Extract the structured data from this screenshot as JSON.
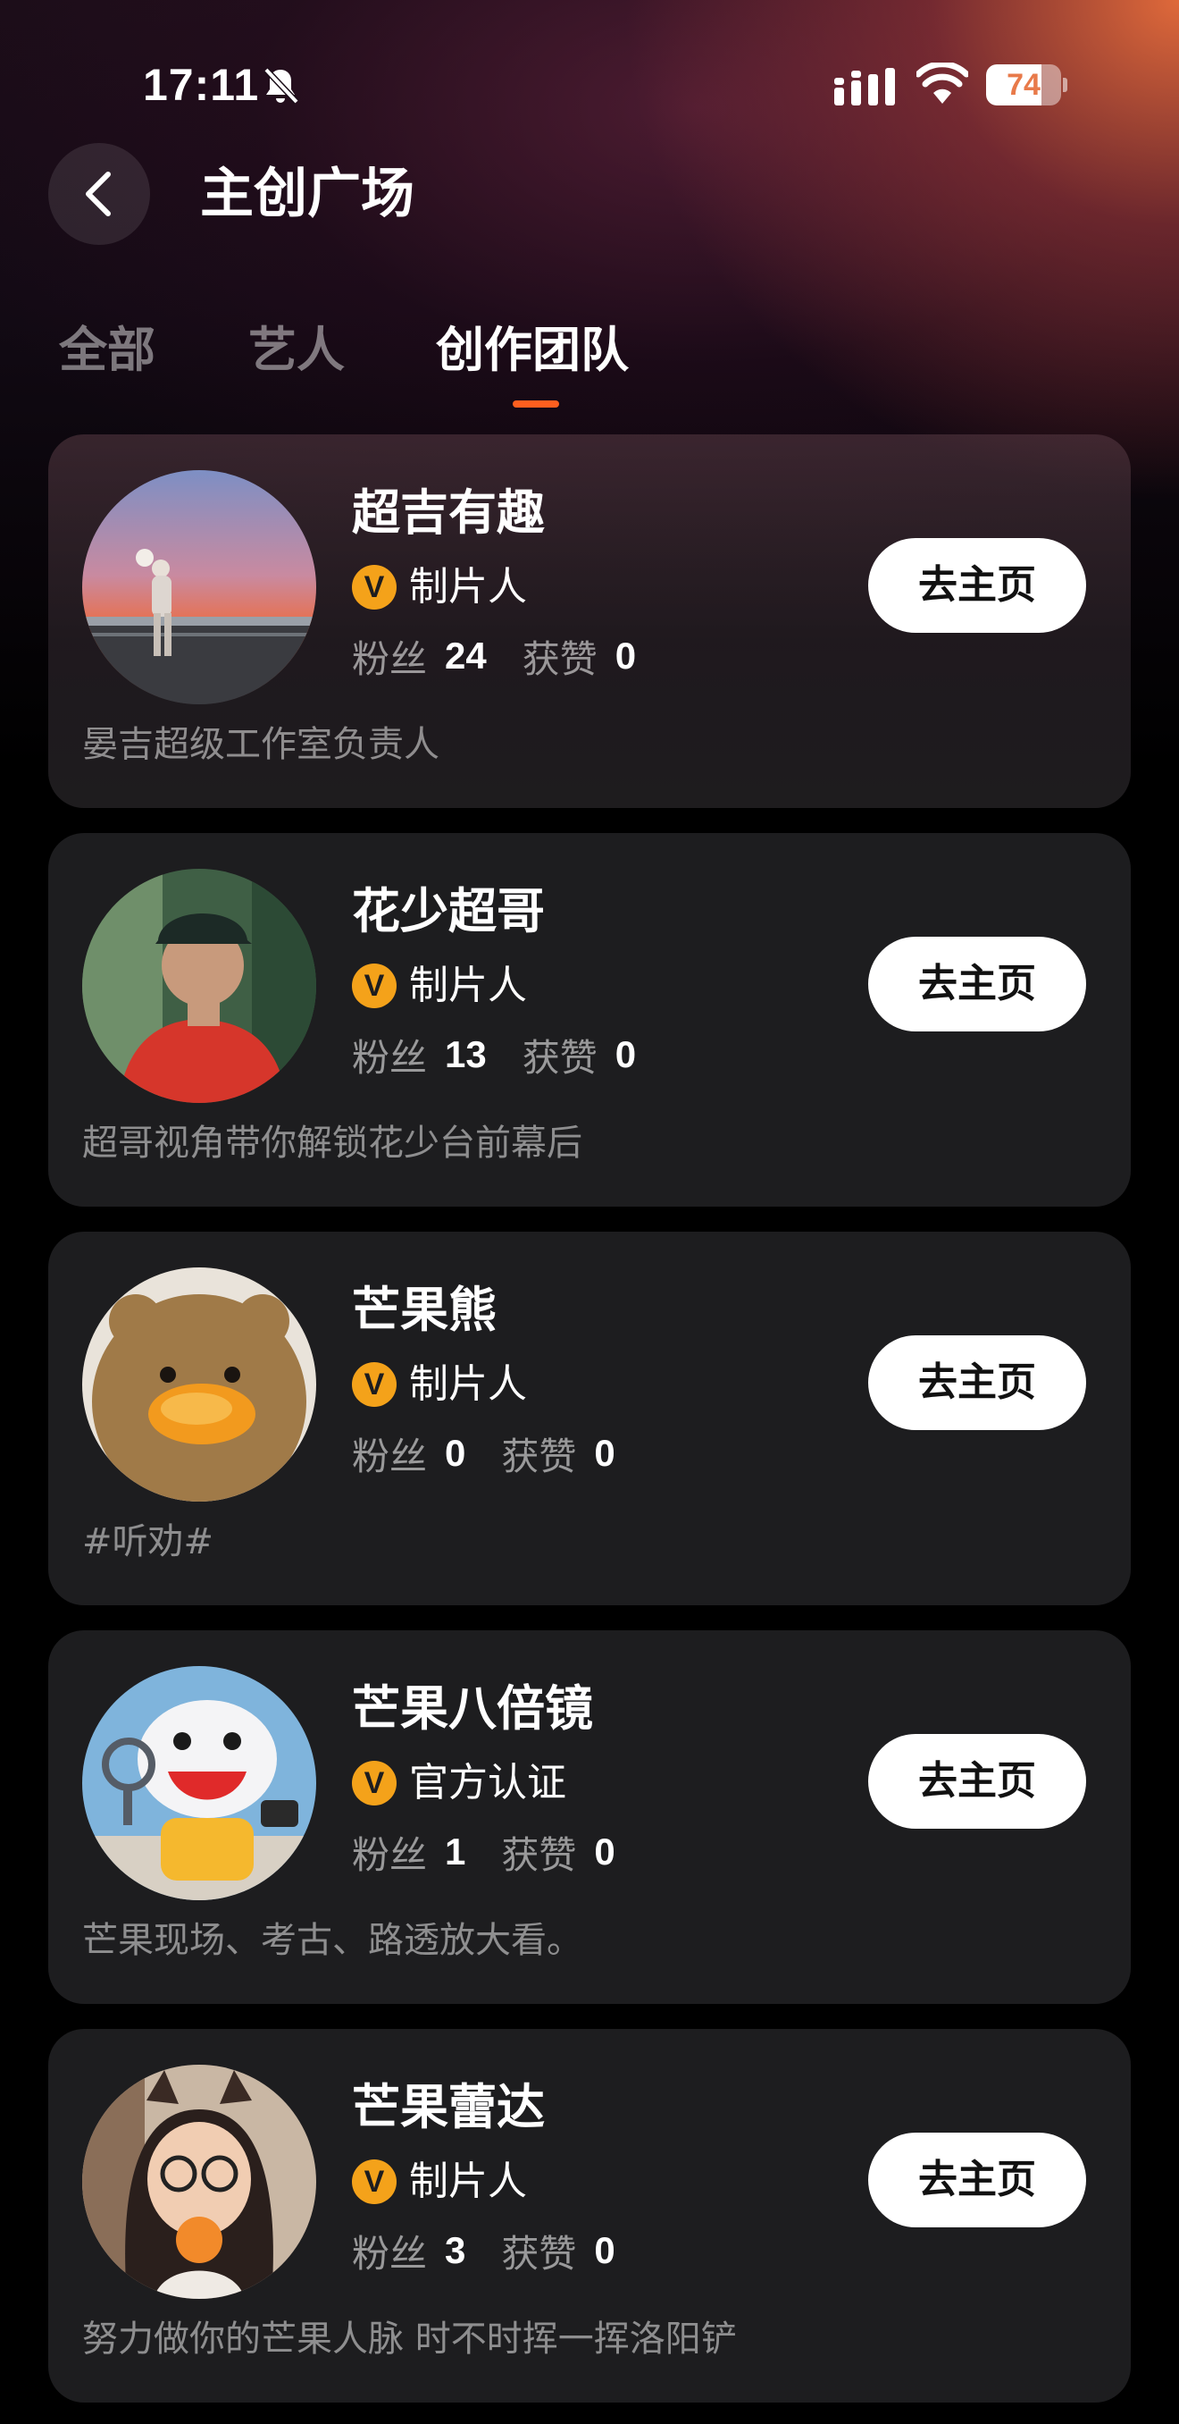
{
  "status_bar": {
    "time": "17:11",
    "battery_level": "74",
    "battery_fraction": 0.74
  },
  "header": {
    "title": "主创广场"
  },
  "tabs": [
    {
      "label": "全部",
      "active": false
    },
    {
      "label": "艺人",
      "active": false
    },
    {
      "label": "创作团队",
      "active": true
    }
  ],
  "colors": {
    "accent": "#ff5f1f",
    "badge": "#f4a21a",
    "card": "#1d1d1f"
  },
  "labels": {
    "fans": "粉丝",
    "likes": "获赞",
    "badge_letter": "V",
    "home_button": "去主页"
  },
  "creators": [
    {
      "name": "超吉有趣",
      "role": "制片人",
      "fans": "24",
      "likes": "0",
      "description": "晏吉超级工作室负责人"
    },
    {
      "name": "花少超哥",
      "role": "制片人",
      "fans": "13",
      "likes": "0",
      "description": "超哥视角带你解锁花少台前幕后"
    },
    {
      "name": "芒果熊",
      "role": "制片人",
      "fans": "0",
      "likes": "0",
      "description": "#听劝#"
    },
    {
      "name": "芒果八倍镜",
      "role": "官方认证",
      "fans": "1",
      "likes": "0",
      "description": "芒果现场、考古、路透放大看。"
    },
    {
      "name": "芒果蕾达",
      "role": "制片人",
      "fans": "3",
      "likes": "0",
      "description": "努力做你的芒果人脉 时不时挥一挥洛阳铲"
    }
  ]
}
